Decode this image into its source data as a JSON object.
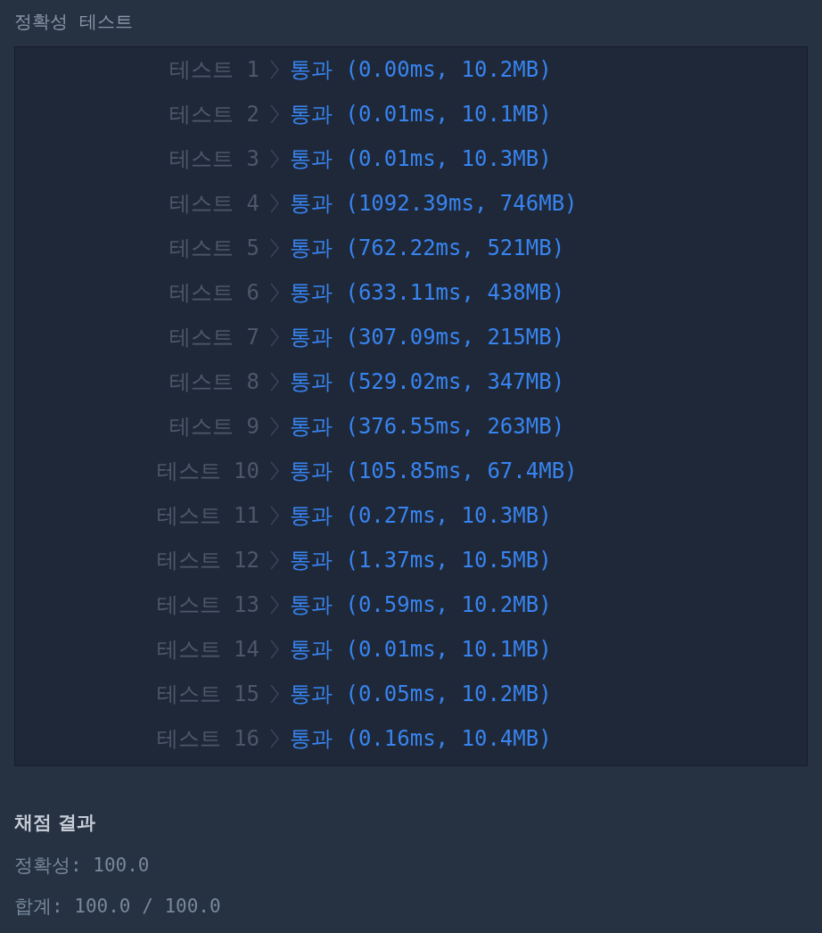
{
  "header": {
    "title": "정확성  테스트"
  },
  "tests": [
    {
      "label": "테스트 1",
      "result": "통과 (0.00ms, 10.2MB)",
      "passed": true
    },
    {
      "label": "테스트 2",
      "result": "통과 (0.01ms, 10.1MB)",
      "passed": true
    },
    {
      "label": "테스트 3",
      "result": "통과 (0.01ms, 10.3MB)",
      "passed": true
    },
    {
      "label": "테스트 4",
      "result": "통과 (1092.39ms, 746MB)",
      "passed": true
    },
    {
      "label": "테스트 5",
      "result": "통과 (762.22ms, 521MB)",
      "passed": true
    },
    {
      "label": "테스트 6",
      "result": "통과 (633.11ms, 438MB)",
      "passed": true
    },
    {
      "label": "테스트 7",
      "result": "통과 (307.09ms, 215MB)",
      "passed": true
    },
    {
      "label": "테스트 8",
      "result": "통과 (529.02ms, 347MB)",
      "passed": true
    },
    {
      "label": "테스트 9",
      "result": "통과 (376.55ms, 263MB)",
      "passed": true
    },
    {
      "label": "테스트 10",
      "result": "통과 (105.85ms, 67.4MB)",
      "passed": true
    },
    {
      "label": "테스트 11",
      "result": "통과 (0.27ms, 10.3MB)",
      "passed": true
    },
    {
      "label": "테스트 12",
      "result": "통과 (1.37ms, 10.5MB)",
      "passed": true
    },
    {
      "label": "테스트 13",
      "result": "통과 (0.59ms, 10.2MB)",
      "passed": true
    },
    {
      "label": "테스트 14",
      "result": "통과 (0.01ms, 10.1MB)",
      "passed": true
    },
    {
      "label": "테스트 15",
      "result": "통과 (0.05ms, 10.2MB)",
      "passed": true
    },
    {
      "label": "테스트 16",
      "result": "통과 (0.16ms, 10.4MB)",
      "passed": true
    }
  ],
  "summary": {
    "title": "채점 결과",
    "lines": [
      "정확성: 100.0",
      "합계: 100.0 / 100.0"
    ]
  }
}
